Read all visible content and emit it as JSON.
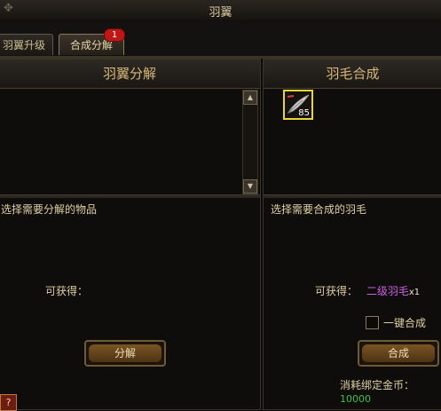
{
  "window": {
    "title": "羽翼"
  },
  "tabs": [
    {
      "label": "羽翼升级",
      "active": false
    },
    {
      "label": "合成分解",
      "active": true,
      "badge": "1"
    }
  ],
  "left_panel": {
    "header": "羽翼分解",
    "select_prompt": "选择需要分解的物品",
    "obtain_label": "可获得：",
    "button_label": "分解"
  },
  "right_panel": {
    "header": "羽毛合成",
    "item": {
      "quantity": "85",
      "icon": "feather-icon"
    },
    "select_prompt": "选择需要合成的羽毛",
    "obtain_label": "可获得：",
    "obtain_item": "二级羽毛",
    "obtain_count": "x1",
    "one_click_label": "一键合成",
    "one_click_checked": false,
    "button_label": "合成",
    "cost_label": "消耗绑定金币：",
    "cost_value": "10000"
  },
  "colors": {
    "accent_gold": "#d6b77a",
    "item_border": "#e9d634",
    "purple_text": "#d15ee6",
    "green_text": "#3fc23f",
    "badge_red": "#c01616"
  }
}
